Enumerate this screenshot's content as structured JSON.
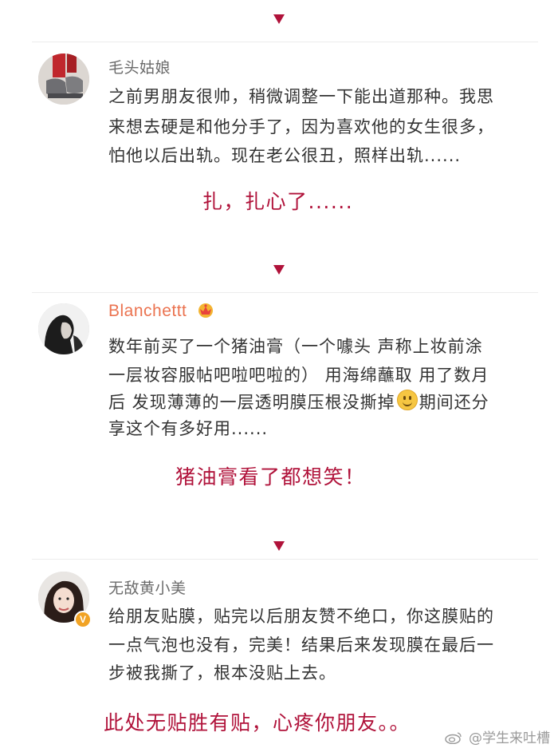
{
  "comments": [
    {
      "username": "毛头姑娘",
      "lines": [
        "之前男朋友很帅，稍微调整一下能出道那种。我思",
        "来想去硬是和他分手了，因为喜欢他的女生很多，",
        "怕他以后出轨。现在老公很丑，照样出轨......"
      ],
      "reaction": "扎，扎心了......"
    },
    {
      "username": "Blanchettt",
      "badge_icon": "crown-icon",
      "lines": [
        "数年前买了一个猪油膏（一个噱头 声称上妆前涂",
        "一层妆容服帖吧啦吧啦的） 用海绵蘸取 用了数月",
        "后 发现薄薄的一层透明膜压根没撕掉",
        "期间还分",
        "享这个有多好用......"
      ],
      "emoji_icon": "smile-emoji-icon",
      "reaction": "猪油膏看了都想笑！"
    },
    {
      "username": "无敌黄小美",
      "verified_badge": "V",
      "lines": [
        "给朋友贴膜，贴完以后朋友赞不绝口，你这膜贴的",
        "一点气泡也没有，完美！结果后来发现膜在最后一",
        "步被我撕了，根本没贴上去。"
      ],
      "reaction": "此处无贴胜有贴，心疼你朋友。。"
    }
  ],
  "watermark": "@学生来吐槽",
  "colors": {
    "accent": "#b0123a",
    "username_orange": "#eb7350",
    "text": "#333333"
  }
}
